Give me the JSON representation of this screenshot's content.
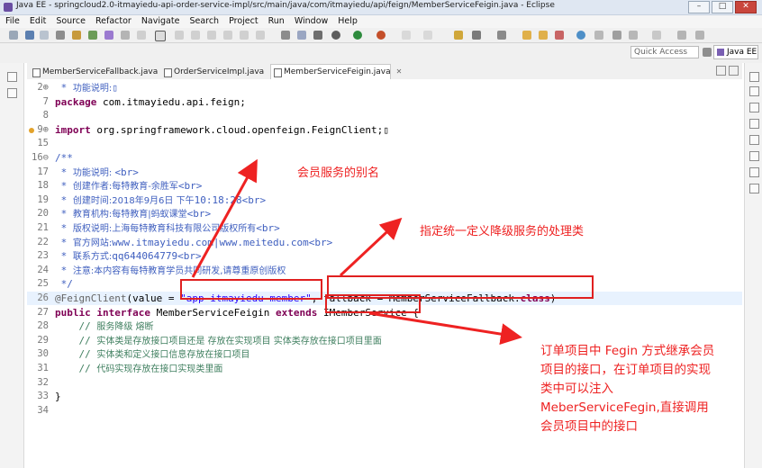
{
  "window": {
    "title": "Java EE - springcloud2.0-itmayiedu-api-order-service-impl/src/main/java/com/itmayiedu/api/feign/MemberServiceFeigin.java - Eclipse",
    "min": "–",
    "max": "□",
    "close": "✕"
  },
  "menu": [
    "File",
    "Edit",
    "Source",
    "Refactor",
    "Navigate",
    "Search",
    "Project",
    "Run",
    "Window",
    "Help"
  ],
  "toolbar": {
    "quick_access_placeholder": "Quick Access",
    "perspective_label": "Java EE"
  },
  "tabs": [
    {
      "label": "MemberServiceFallback.java",
      "active": false
    },
    {
      "label": "OrderServiceImpl.java",
      "active": false
    },
    {
      "label": "MemberServiceFeigin.java",
      "active": true,
      "close": "✕"
    }
  ],
  "editor": {
    "lines": [
      {
        "num": "2⊕",
        "segs": [
          {
            "c": "cm",
            "t": " * "
          },
          {
            "c": "cm cjk",
            "t": "功能说明:"
          },
          {
            "c": "cm",
            "t": "▯"
          }
        ]
      },
      {
        "num": "7",
        "segs": [
          {
            "c": "kw",
            "t": "package"
          },
          {
            "c": "",
            "t": " com.itmayiedu.api.feign;"
          }
        ]
      },
      {
        "num": "8",
        "segs": []
      },
      {
        "num": "9⊕",
        "marker": true,
        "segs": [
          {
            "c": "kw",
            "t": "import"
          },
          {
            "c": "",
            "t": " org.springframework.cloud.openfeign.FeignClient;▯"
          }
        ]
      },
      {
        "num": "15",
        "segs": []
      },
      {
        "num": "16⊖",
        "segs": [
          {
            "c": "cm",
            "t": "/**"
          }
        ]
      },
      {
        "num": "17",
        "segs": [
          {
            "c": "cm",
            "t": " * "
          },
          {
            "c": "cm cjk",
            "t": "功能说明: "
          },
          {
            "c": "cm",
            "t": "<br>"
          }
        ]
      },
      {
        "num": "18",
        "segs": [
          {
            "c": "cm",
            "t": " * "
          },
          {
            "c": "cm cjk",
            "t": "创建作者:每特教育-余胜军"
          },
          {
            "c": "cm",
            "t": "<br>"
          }
        ]
      },
      {
        "num": "19",
        "segs": [
          {
            "c": "cm",
            "t": " * "
          },
          {
            "c": "cm cjk",
            "t": "创建时间:2018年9月6日 下午"
          },
          {
            "c": "cm",
            "t": "10:18:28<br>"
          }
        ]
      },
      {
        "num": "20",
        "segs": [
          {
            "c": "cm",
            "t": " * "
          },
          {
            "c": "cm cjk",
            "t": "教育机构:每特教育|蚂蚁课堂"
          },
          {
            "c": "cm",
            "t": "<br>"
          }
        ]
      },
      {
        "num": "21",
        "segs": [
          {
            "c": "cm",
            "t": " * "
          },
          {
            "c": "cm cjk",
            "t": "版权说明:上海每特教育科技有限公司版权所有"
          },
          {
            "c": "cm",
            "t": "<br>"
          }
        ]
      },
      {
        "num": "22",
        "segs": [
          {
            "c": "cm",
            "t": " * "
          },
          {
            "c": "cm cjk",
            "t": "官方网站:"
          },
          {
            "c": "cm",
            "t": "www.itmayiedu.com|www.meitedu.com<br>"
          }
        ]
      },
      {
        "num": "23",
        "segs": [
          {
            "c": "cm",
            "t": " * "
          },
          {
            "c": "cm cjk",
            "t": "联系方式:"
          },
          {
            "c": "cm",
            "t": "qq644064779<br>"
          }
        ]
      },
      {
        "num": "24",
        "segs": [
          {
            "c": "cm",
            "t": " * "
          },
          {
            "c": "cm cjk",
            "t": "注意:本内容有每特教育学员共同研发,请尊重原创版权"
          }
        ]
      },
      {
        "num": "25",
        "segs": [
          {
            "c": "cm",
            "t": " */"
          }
        ]
      },
      {
        "num": "26",
        "hl": true,
        "segs": [
          {
            "c": "an",
            "t": "@FeignClient"
          },
          {
            "c": "",
            "t": "(value = "
          },
          {
            "c": "st",
            "t": "\"app-itmayiedu-member\""
          },
          {
            "c": "",
            "t": ", fallback = MemberServiceFallback."
          },
          {
            "c": "kw",
            "t": "class"
          },
          {
            "c": "",
            "t": ")"
          }
        ]
      },
      {
        "num": "27",
        "segs": [
          {
            "c": "kw",
            "t": "public interface"
          },
          {
            "c": "",
            "t": " MemberServiceFeigin "
          },
          {
            "c": "kw",
            "t": "extends"
          },
          {
            "c": "",
            "t": " IMemberService {"
          }
        ]
      },
      {
        "num": "28",
        "segs": [
          {
            "c": "lc",
            "t": "    // "
          },
          {
            "c": "lc cjk",
            "t": "服务降级 熔断"
          }
        ]
      },
      {
        "num": "29",
        "segs": [
          {
            "c": "lc",
            "t": "    // "
          },
          {
            "c": "lc cjk",
            "t": "实体类是存放接口项目还是 存放在实现项目 实体类存放在接口项目里面"
          }
        ]
      },
      {
        "num": "30",
        "segs": [
          {
            "c": "lc",
            "t": "    // "
          },
          {
            "c": "lc cjk",
            "t": "实体类和定义接口信息存放在接口项目"
          }
        ]
      },
      {
        "num": "31",
        "segs": [
          {
            "c": "lc",
            "t": "    // "
          },
          {
            "c": "lc cjk",
            "t": "代码实现存放在接口实现类里面"
          }
        ]
      },
      {
        "num": "32",
        "segs": []
      },
      {
        "num": "33",
        "segs": [
          {
            "c": "",
            "t": "}"
          }
        ]
      },
      {
        "num": "34",
        "segs": []
      }
    ]
  },
  "annotations": {
    "alias_note": "会员服务的别名",
    "fallback_note": "指定统一定义降级服务的处理类",
    "inherit_note": [
      "订单项目中 Fegin 方式继承会员",
      "项目的接口，在订单项目的实现",
      "类中可以注入",
      "MeberServiceFegin,直接调用",
      "会员项目中的接口"
    ],
    "color": "#ee2222"
  }
}
